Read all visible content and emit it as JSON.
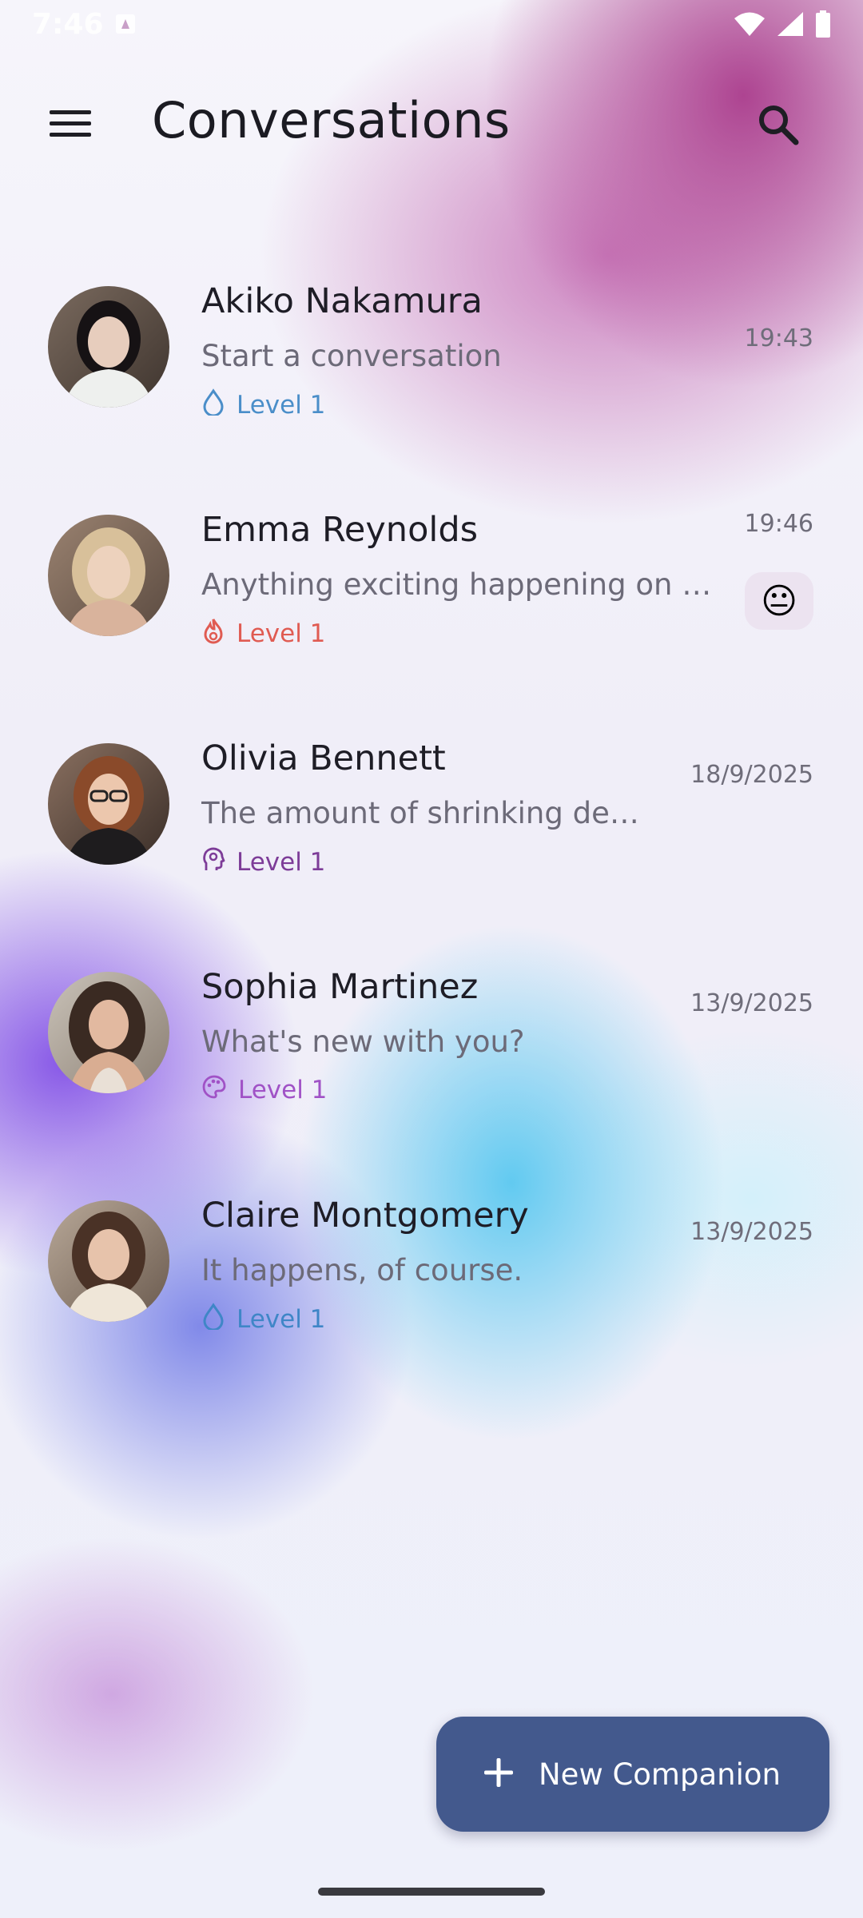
{
  "status_bar": {
    "time": "7:46"
  },
  "app_bar": {
    "title": "Conversations",
    "menu_icon": "menu-icon",
    "search_icon": "search-icon"
  },
  "conversations": [
    {
      "name": "Akiko Nakamura",
      "preview": "Start a conversation",
      "level": "Level 1",
      "level_icon": "water-drop-icon",
      "level_color": "#4a8ec9",
      "time": "19:43"
    },
    {
      "name": "Emma Reynolds",
      "preview": "Anything exciting happening on …",
      "level": "Level 1",
      "level_icon": "flame-icon",
      "level_color": "#e05b52",
      "time": "19:46",
      "mood": "😐"
    },
    {
      "name": "Olivia Bennett",
      "preview": "The amount of shrinking de…",
      "level": "Level 1",
      "level_icon": "brain-head-icon",
      "level_color": "#7d3c98",
      "time": "18/9/2025"
    },
    {
      "name": "Sophia Martinez",
      "preview": "What's new with you?",
      "level": "Level 1",
      "level_icon": "palette-icon",
      "level_color": "#a052c6",
      "time": "13/9/2025"
    },
    {
      "name": "Claire Montgomery",
      "preview": "It happens, of course.",
      "level": "Level 1",
      "level_icon": "water-drop-icon",
      "level_color": "#3f86c7",
      "time": "13/9/2025"
    }
  ],
  "fab": {
    "label": "New Companion",
    "icon": "plus-icon"
  },
  "colors": {
    "fab": "#43598d",
    "accent_magenta": "#aa3c8c",
    "accent_violet": "#8250e6",
    "accent_cyan": "#5ac8f0"
  }
}
